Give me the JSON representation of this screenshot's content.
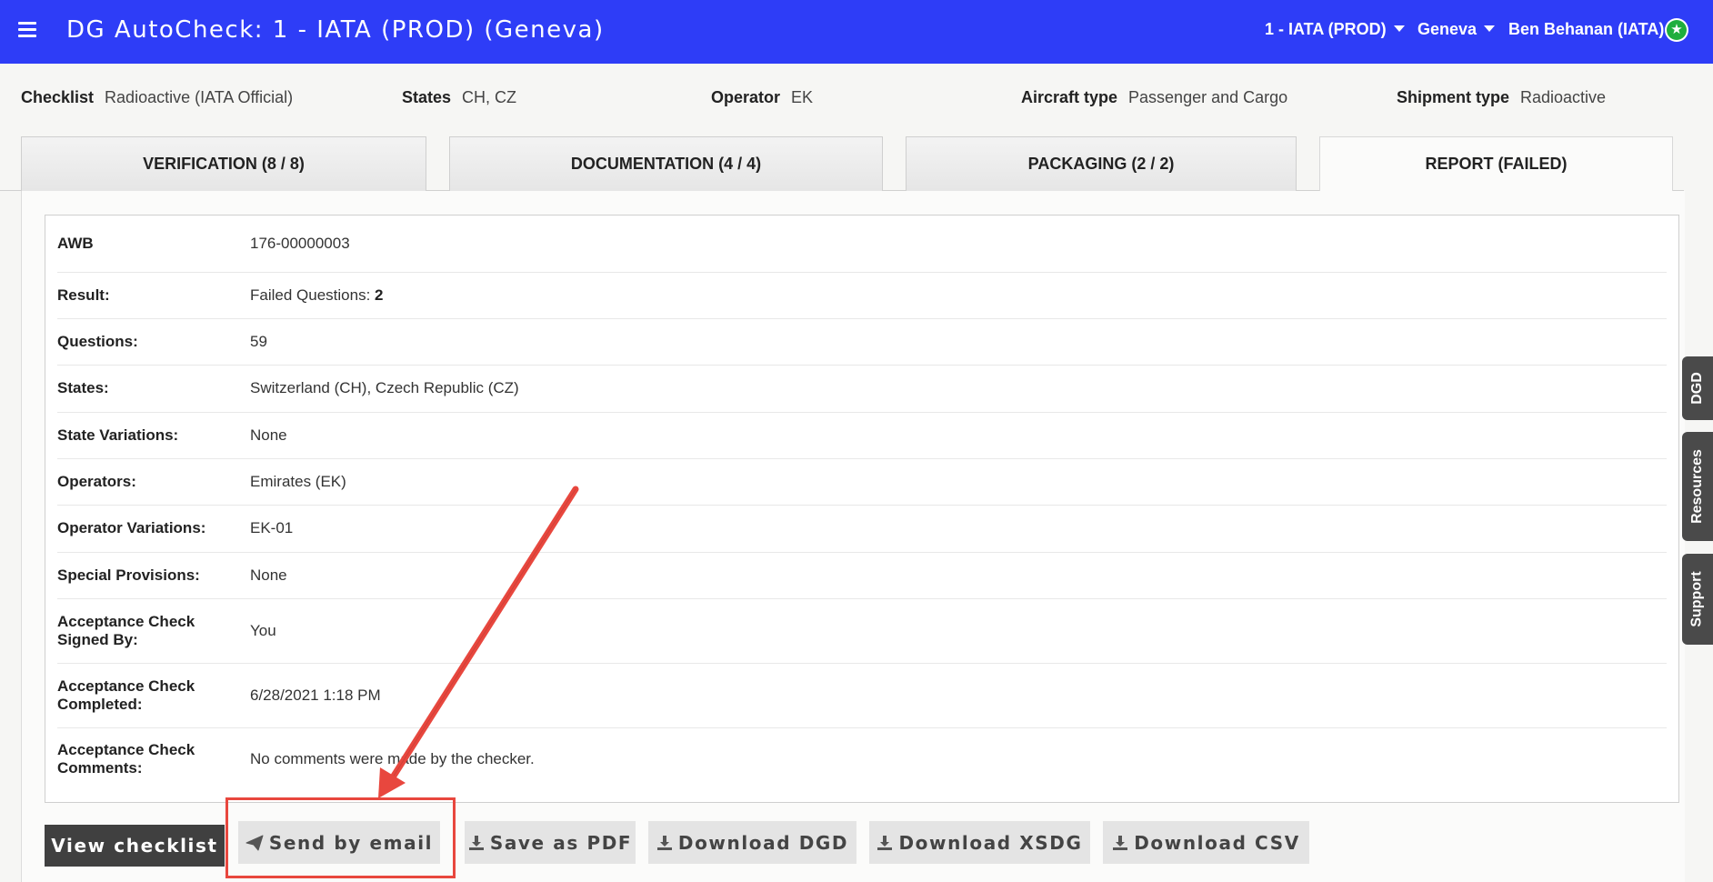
{
  "header": {
    "title": "DG AutoCheck: 1 - IATA (PROD) (Geneva)",
    "org_menu": "1 - IATA (PROD)",
    "location_menu": "Geneva",
    "user_menu": "Ben Behanan (IATA)",
    "user_badge": "★",
    "bar_color": "#2e3df7"
  },
  "info": {
    "checklist_label": "Checklist",
    "checklist_value": "Radioactive (IATA Official)",
    "states_label": "States",
    "states_value": "CH, CZ",
    "operator_label": "Operator",
    "operator_value": "EK",
    "aircraft_label": "Aircraft type",
    "aircraft_value": "Passenger and Cargo",
    "shipment_label": "Shipment type",
    "shipment_value": "Radioactive"
  },
  "tabs": [
    {
      "label": "VERIFICATION (8 / 8)"
    },
    {
      "label": "DOCUMENTATION (4 / 4)"
    },
    {
      "label": "PACKAGING (2 / 2)"
    },
    {
      "label": "REPORT (FAILED)",
      "active": true
    }
  ],
  "report": {
    "rows": [
      {
        "key": "AWB",
        "value": "176-00000003"
      },
      {
        "key": "Result:",
        "value": "Failed Questions: ",
        "value_strong": "2"
      },
      {
        "key": "Questions:",
        "value": "59"
      },
      {
        "key": "States:",
        "value": "Switzerland (CH), Czech Republic (CZ)"
      },
      {
        "key": "State Variations:",
        "value": "None"
      },
      {
        "key": "Operators:",
        "value": "Emirates (EK)"
      },
      {
        "key": "Operator Variations:",
        "value": "EK-01"
      },
      {
        "key": "Special Provisions:",
        "value": "None"
      },
      {
        "key": "Acceptance Check Signed By:",
        "value": "You"
      },
      {
        "key": "Acceptance Check Completed:",
        "value": "6/28/2021 1:18 PM"
      },
      {
        "key": "Acceptance Check Comments:",
        "value": "No comments were made by the checker."
      }
    ]
  },
  "actions": {
    "view_checklist": "View checklist",
    "send_email": "Send by email",
    "save_pdf": "Save as PDF",
    "download_dgd": "Download DGD",
    "download_xsdg": "Download XSDG",
    "download_csv": "Download CSV",
    "annotation_color": "#e8473e"
  },
  "side_tabs": {
    "dgd": "DGD",
    "resources": "Resources",
    "support": "Support"
  }
}
